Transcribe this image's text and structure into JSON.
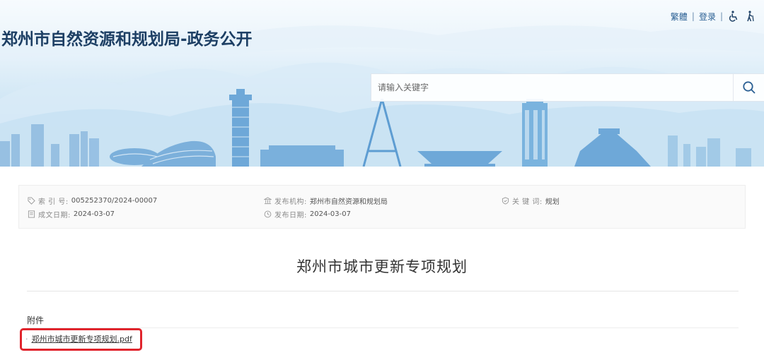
{
  "header": {
    "site_title": "郑州市自然资源和规划局-政务公开",
    "traditional_label": "繁體",
    "login_label": "登录",
    "accessibility_icon": "wheelchair-icon",
    "elderly_icon": "elderly-icon"
  },
  "search": {
    "placeholder": "请输入关键字",
    "button_icon": "search-icon"
  },
  "meta": {
    "index_label": "索 引 号:",
    "index_value": "005252370/2024-00007",
    "issuer_label": "发布机构:",
    "issuer_value": "郑州市自然资源和规划局",
    "keyword_label": "关 键 词:",
    "keyword_value": "规划",
    "created_label": "成文日期:",
    "created_value": "2024-03-07",
    "published_label": "发布日期:",
    "published_value": "2024-03-07"
  },
  "article": {
    "title": "郑州市城市更新专项规划"
  },
  "attachments": {
    "heading": "附件",
    "items": [
      {
        "name": "郑州市城市更新专项规划.pdf"
      }
    ]
  },
  "colors": {
    "title_blue": "#1d3f64",
    "link_blue": "#2a5f93",
    "highlight_red": "#e0242c"
  }
}
